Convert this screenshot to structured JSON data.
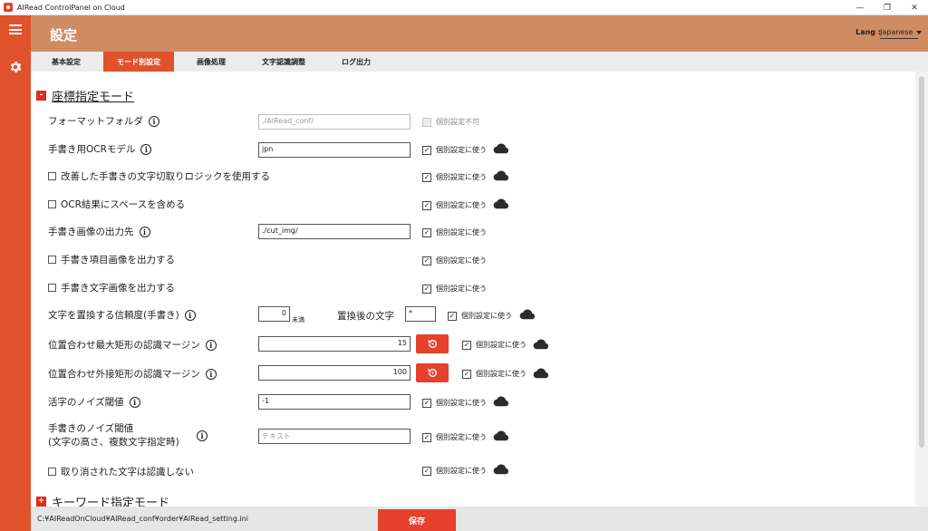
{
  "window": {
    "title": "AIRead ControlPanel on Cloud",
    "controls": [
      "—",
      "❐",
      "✕"
    ]
  },
  "header": {
    "title": "設定",
    "lang_label": "Lang :",
    "lang_value": "Japanese"
  },
  "tabs": [
    {
      "label": "基本設定"
    },
    {
      "label": "モード別設定",
      "active": true
    },
    {
      "label": "画像処理"
    },
    {
      "label": "文字認識調整"
    },
    {
      "label": "ログ出力"
    }
  ],
  "section1": {
    "toggle": "-",
    "title": "座標指定モード"
  },
  "section2": {
    "toggle": "+",
    "title": "キーワード指定モード"
  },
  "rows": {
    "format_folder": {
      "label": "フォーマットフォルダ",
      "value": "./AIRead_conf/",
      "indiv": "個別設定不可"
    },
    "ocr_model": {
      "label": "手書き用OCRモデル",
      "value": "jpn",
      "indiv": "個別設定に使う"
    },
    "improved_logic": {
      "label": "改善した手書きの文字切取りロジックを使用する",
      "indiv": "個別設定に使う"
    },
    "include_space": {
      "label": "OCR結果にスペースを含める",
      "indiv": "個別設定に使う"
    },
    "output_dest": {
      "label": "手書き画像の出力先",
      "value": "./cut_img/",
      "indiv": "個別設定に使う"
    },
    "item_image": {
      "label": "手書き項目画像を出力する",
      "indiv": "個別設定に使う"
    },
    "char_image": {
      "label": "手書き文字画像を出力する",
      "indiv": "個別設定に使う"
    },
    "replace_conf": {
      "label": "文字を置換する信頼度(手書き)",
      "value": "0",
      "unit": "未満",
      "after_label": "置換後の文字",
      "after_value": "*",
      "indiv": "個別設定に使う"
    },
    "max_rect_margin": {
      "label": "位置合わせ最大矩形の認識マージン",
      "value": "15",
      "indiv": "個別設定に使う"
    },
    "outer_rect_margin": {
      "label": "位置合わせ外接矩形の認識マージン",
      "value": "100",
      "indiv": "個別設定に使う"
    },
    "print_noise": {
      "label": "活字のノイズ閾値",
      "value": "-1",
      "indiv": "個別設定に使う"
    },
    "hand_noise": {
      "label_line1": "手書きのノイズ閾値",
      "label_line2": "(文字の高さ、複数文字指定時)",
      "placeholder": "テキスト",
      "indiv": "個別設定に使う"
    },
    "ignore_struck": {
      "label": "取り消された文字は認識しない",
      "indiv": "個別設定に使う"
    }
  },
  "icons": {
    "info": "i",
    "check": "✓"
  },
  "footer": {
    "path": "C:¥AIReadOnCloud¥AIRead_conf¥order¥AIRead_setting.ini",
    "save": "保存"
  },
  "colors": {
    "accent": "#e0522c",
    "header": "#cf8c63",
    "danger": "#e5412c"
  }
}
